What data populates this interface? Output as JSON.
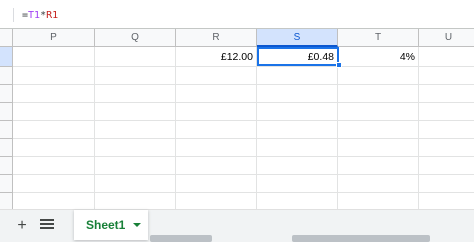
{
  "formula_bar": {
    "formula_prefix": "=",
    "ref_1": "T1",
    "operator": "*",
    "ref_2": "R1",
    "ref_1_color": "#a142f4",
    "ref_2_color": "#c5221f"
  },
  "columns": [
    "P",
    "Q",
    "R",
    "S",
    "T",
    "U"
  ],
  "selected_column": "S",
  "row1": {
    "R": "£12.00",
    "S": "£0.48",
    "T": "4%"
  },
  "sheet_tabs": {
    "add_icon": "plus-icon",
    "list_icon": "hamburger-icon",
    "active_tab": "Sheet1",
    "active_color": "#188038"
  },
  "selection_color": "#1a73e8"
}
